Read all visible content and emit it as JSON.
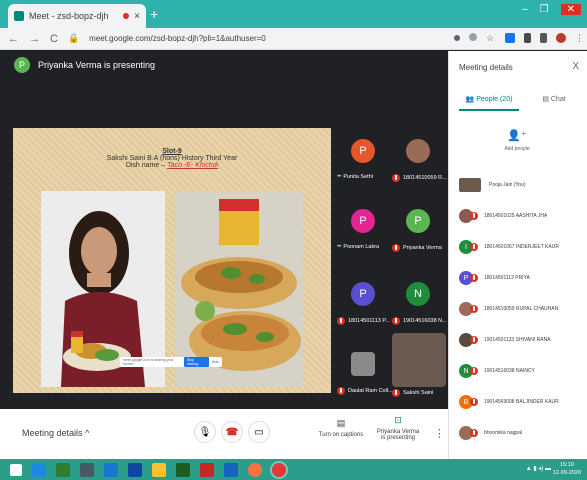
{
  "browser": {
    "tab_title": "Meet - zsd-bopz-djh",
    "tab_close": "×",
    "new_tab": "+",
    "url": "meet.google.com/zsd-bopz-djh?pli=1&authuser=0",
    "window_controls": [
      "–",
      "❐",
      "✕"
    ]
  },
  "meet": {
    "presenter_initial": "P",
    "presenter_banner": "Priyanka Verma is presenting"
  },
  "slide": {
    "heading": "Slot-9",
    "subtitle": "Sakshi Saini B.A (hons) History Third Year",
    "dish_prefix": "Dish name – ",
    "dish_name": "Taco -E- Khichdi",
    "share_text": "meet.google.com is sharing your screen.",
    "stop_sharing": "Stop sharing",
    "hide": "Hide"
  },
  "tiles": [
    {
      "initial": "P",
      "name": "Punita Sethi",
      "color": "#e8562b",
      "muted": false
    },
    {
      "initial": "",
      "name": "18014510059 R...",
      "color": "#9b6b5a",
      "muted": true
    },
    {
      "initial": "P",
      "name": "Poonam Lakra",
      "color": "#e52592",
      "muted": false
    },
    {
      "initial": "P",
      "name": "Priyanka Verma",
      "color": "#5ab552",
      "muted": true
    },
    {
      "initial": "P",
      "name": "18014501113 P...",
      "color": "#5b4ed1",
      "muted": true
    },
    {
      "initial": "N",
      "name": "19014516038 N...",
      "color": "#1e8e3e",
      "muted": true
    },
    {
      "initial": "",
      "name": "Daulat Ram Coll...",
      "color": "#8a8a8a",
      "muted": true
    },
    {
      "initial": "",
      "name": "Sakshi Saini",
      "color": "#7a6a60",
      "muted": true
    }
  ],
  "bottombar": {
    "meeting_details": "Meeting details",
    "captions": "Turn on captions",
    "presenting_line1": "Priyanka Verma",
    "presenting_line2": "is presenting"
  },
  "panel": {
    "title": "Meeting details",
    "close": "X",
    "tab_people": "People (20)",
    "tab_chat": "Chat",
    "add_people": "Add people",
    "people": [
      {
        "initial": "",
        "name": "Pooja Jain (You)",
        "color": "#6d5a4a"
      },
      {
        "initial": "",
        "name": "18014501025 AASHITA JHA",
        "color": "#8c5a4f"
      },
      {
        "initial": "I",
        "name": "18014501067 INDERJEET KAUR",
        "color": "#1e8e3e"
      },
      {
        "initial": "P",
        "name": "18014501113 PRIYA",
        "color": "#5b4ed1"
      },
      {
        "initial": "",
        "name": "18014510059 RUPAL CHAUHAN",
        "color": "#a06a5a"
      },
      {
        "initial": "",
        "name": "19014501133 SHIVANI RANA",
        "color": "#5a4a40"
      },
      {
        "initial": "N",
        "name": "19014516038 NAINCY",
        "color": "#1e8e3e"
      },
      {
        "initial": "B",
        "name": "19014569008 BALJINDER KAUR",
        "color": "#e8710a"
      },
      {
        "initial": "",
        "name": "bhoomika nagpal",
        "color": "#9b6b5a"
      }
    ]
  },
  "taskbar": {
    "time": "15:19",
    "date": "12-09-2020"
  }
}
